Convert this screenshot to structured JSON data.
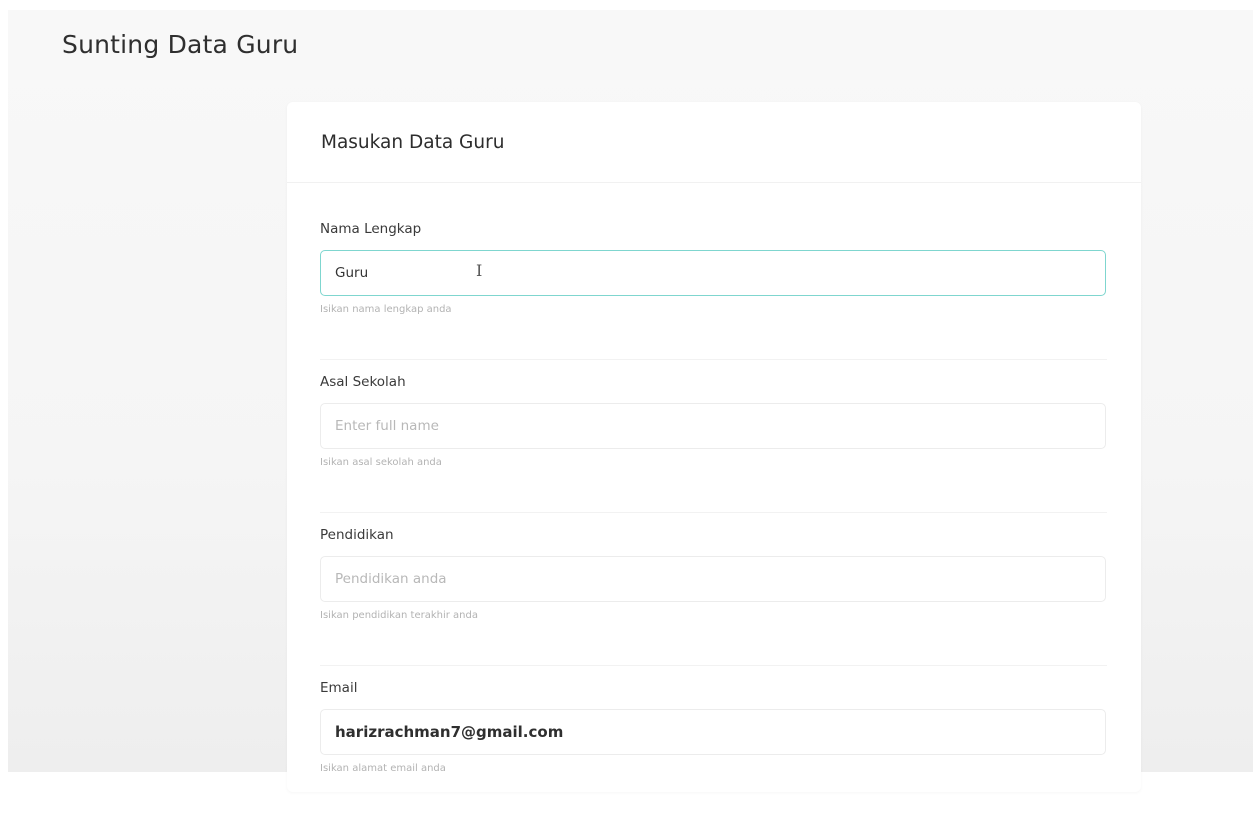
{
  "page": {
    "title": "Sunting Data Guru"
  },
  "card": {
    "title": "Masukan Data Guru"
  },
  "fields": [
    {
      "label": "Nama Lengkap",
      "value": "Guru",
      "placeholder": "",
      "help": "Isikan nama lengkap anda"
    },
    {
      "label": "Asal Sekolah",
      "value": "",
      "placeholder": "Enter full name",
      "help": "Isikan asal sekolah anda"
    },
    {
      "label": "Pendidikan",
      "value": "",
      "placeholder": "Pendidikan anda",
      "help": "Isikan pendidikan terakhir anda"
    },
    {
      "label": "Email",
      "value": "harizrachman7@gmail.com",
      "placeholder": "",
      "help": "Isikan alamat email anda"
    }
  ],
  "cursor_glyph": "I",
  "colors": {
    "focus_border": "#7fd6cf",
    "background": "#f6f6f6"
  }
}
